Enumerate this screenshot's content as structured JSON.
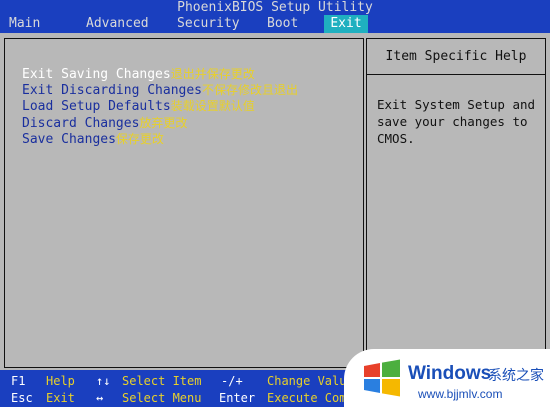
{
  "app": {
    "title": "PhoenixBIOS Setup Utility"
  },
  "menu": {
    "tabs": [
      {
        "label": "Main"
      },
      {
        "label": "Advanced"
      },
      {
        "label": "Security"
      },
      {
        "label": "Boot"
      },
      {
        "label": "Exit",
        "selected": true
      }
    ]
  },
  "exit_options": [
    {
      "label": "Exit Saving Changes",
      "note": "退出并保存更改",
      "highlighted": true
    },
    {
      "label": "Exit Discarding Changes",
      "note": "不保存修改且退出"
    },
    {
      "label": "Load Setup Defaults",
      "note": "装载设置默认值"
    },
    {
      "label": "Discard Changes",
      "note": "放弃更改"
    },
    {
      "label": "Save Changes",
      "note": "保存更改"
    }
  ],
  "help": {
    "heading": "Item Specific Help",
    "text": "Exit System Setup and\nsave your changes to\nCMOS."
  },
  "legend": {
    "row1": {
      "key1": "F1",
      "act1": "Help",
      "key2": "↑↓",
      "act2": "Select Item",
      "key3": "-/+",
      "act3": "Change Value"
    },
    "row2": {
      "key1": "Esc",
      "act1": "Exit",
      "key2": "↔",
      "act2": "Select Menu",
      "key3": "Enter",
      "act3": "Execute Comma"
    }
  },
  "watermark": {
    "brand": "Windows",
    "cn": "系统之家",
    "url": "www.bjjmlv.com"
  },
  "colors": {
    "bios_blue": "#1a3fbf",
    "panel_grey": "#b8b8b8",
    "tab_selected": "#1fb0c0",
    "note_yellow": "#e8d02a"
  }
}
